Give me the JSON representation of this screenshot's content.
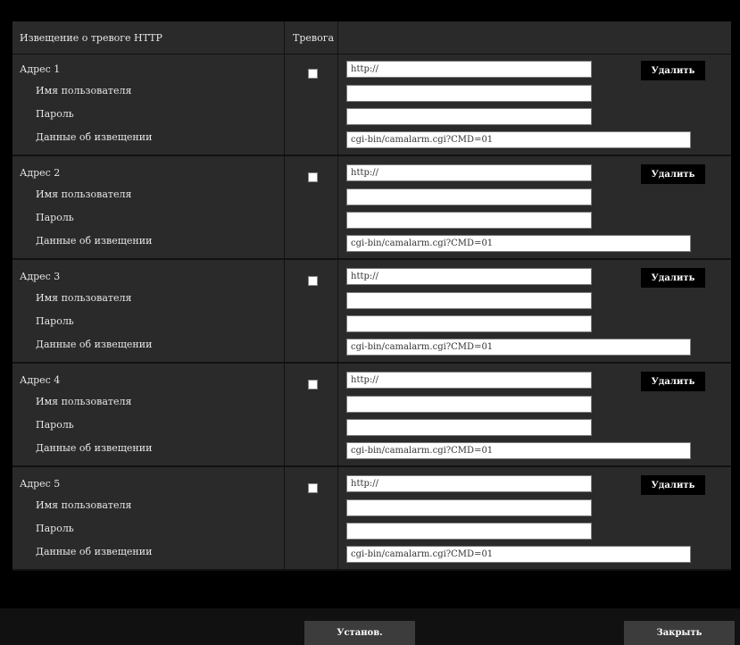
{
  "header": {
    "title": "Извещение о тревоге HTTP",
    "alarm_label": "Тревога"
  },
  "labels": {
    "username": "Имя пользователя",
    "password": "Пароль",
    "notification_data": "Данные об извещении"
  },
  "delete_label": "Удалить",
  "addresses": [
    {
      "label": "Адрес 1",
      "checked": false,
      "url": "http://",
      "username": "",
      "password": "",
      "notification": "cgi-bin/camalarm.cgi?CMD=01"
    },
    {
      "label": "Адрес 2",
      "checked": false,
      "url": "http://",
      "username": "",
      "password": "",
      "notification": "cgi-bin/camalarm.cgi?CMD=01"
    },
    {
      "label": "Адрес 3",
      "checked": false,
      "url": "http://",
      "username": "",
      "password": "",
      "notification": "cgi-bin/camalarm.cgi?CMD=01"
    },
    {
      "label": "Адрес 4",
      "checked": false,
      "url": "http://",
      "username": "",
      "password": "",
      "notification": "cgi-bin/camalarm.cgi?CMD=01"
    },
    {
      "label": "Адрес 5",
      "checked": false,
      "url": "http://",
      "username": "",
      "password": "",
      "notification": "cgi-bin/camalarm.cgi?CMD=01"
    }
  ],
  "footer": {
    "set_label": "Установ.",
    "close_label": "Закрыть"
  }
}
